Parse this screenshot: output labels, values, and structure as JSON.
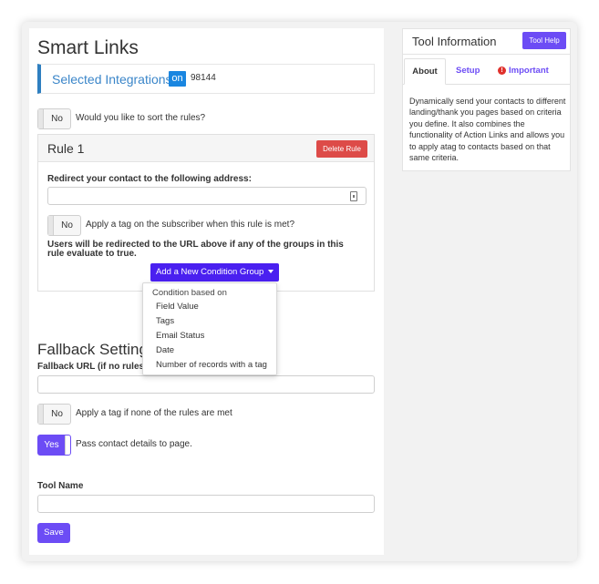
{
  "main": {
    "title": "Smart Links",
    "integrations": {
      "label": "Selected Integrations:",
      "badge": "on",
      "id": "98144"
    },
    "sort_toggle": {
      "state": "No",
      "label": "Would you like to sort the rules?"
    },
    "rule": {
      "title": "Rule 1",
      "delete_label": "Delete Rule",
      "redirect_label": "Redirect your contact to the following address:",
      "redirect_value": "",
      "tag_toggle": {
        "state": "No",
        "label": "Apply a tag on the subscriber when this rule is met?"
      },
      "note": "Users will be redirected to the URL above if any of the groups in this rule evaluate to true.",
      "add_group_label": "Add a New Condition Group"
    },
    "dropdown": {
      "header": "Condition based on",
      "items": [
        "Field Value",
        "Tags",
        "Email Status",
        "Date",
        "Number of records with a tag"
      ]
    },
    "fallback": {
      "title": "Fallback Settings",
      "url_label": "Fallback URL (if no rules ar",
      "url_value": "",
      "tag_toggle": {
        "state": "No",
        "label": "Apply a tag if none of the rules are met"
      },
      "pass_toggle": {
        "state": "Yes",
        "label": "Pass contact details to page."
      }
    },
    "tool_name": {
      "label": "Tool Name",
      "value": ""
    },
    "save_label": "Save"
  },
  "side": {
    "title": "Tool Information",
    "help_label": "Tool Help",
    "tabs": [
      "About",
      "Setup",
      "Important"
    ],
    "about_text": "Dynamically send your contacts to different landing/thank you pages based on criteria you define. It also combines the functionality of Action Links and allows you to apply atag to contacts based on that same criteria."
  },
  "colors": {
    "accent": "#6c4cf5",
    "condition_button": "#4a20f0",
    "delete_button": "#dd4b48",
    "integration_bar": "#2e7fc0",
    "on_badge": "#1a86e0",
    "important_icon": "#e0312c"
  }
}
